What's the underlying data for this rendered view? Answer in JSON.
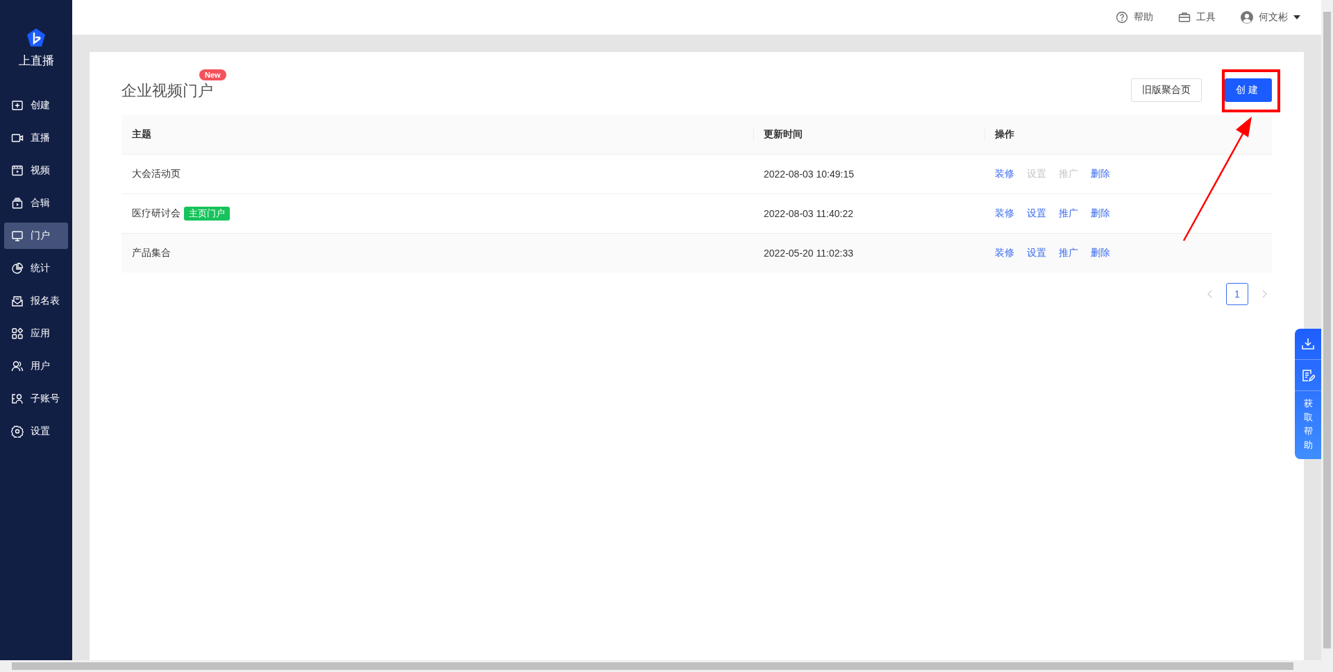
{
  "sidebar": {
    "brand": "上直播",
    "items": [
      {
        "label": "创建",
        "selected": false
      },
      {
        "label": "直播",
        "selected": false
      },
      {
        "label": "视频",
        "selected": false
      },
      {
        "label": "合辑",
        "selected": false
      },
      {
        "label": "门户",
        "selected": true
      },
      {
        "label": "统计",
        "selected": false
      },
      {
        "label": "报名表",
        "selected": false
      },
      {
        "label": "应用",
        "selected": false
      },
      {
        "label": "用户",
        "selected": false
      },
      {
        "label": "子账号",
        "selected": false
      },
      {
        "label": "设置",
        "selected": false
      }
    ]
  },
  "topbar": {
    "help": "帮助",
    "tools": "工具",
    "user": "何文彬"
  },
  "page": {
    "title": "企业视频门户",
    "badge": "New",
    "buttons": [
      {
        "label": "旧版聚合页",
        "kind": "default"
      },
      {
        "label": "创建",
        "kind": "primary"
      }
    ]
  },
  "table": {
    "columns": [
      "主题",
      "更新时间",
      "操作"
    ],
    "rows": [
      {
        "subject": "大会活动页",
        "tag": null,
        "time": "2022-08-03 10:49:15",
        "actions": [
          {
            "label": "装修",
            "disabled": false
          },
          {
            "label": "设置",
            "disabled": true
          },
          {
            "label": "推广",
            "disabled": true
          },
          {
            "label": "删除",
            "disabled": false
          }
        ]
      },
      {
        "subject": "医疗研讨会",
        "tag": "主页门户",
        "time": "2022-08-03 11:40:22",
        "actions": [
          {
            "label": "装修",
            "disabled": false
          },
          {
            "label": "设置",
            "disabled": false
          },
          {
            "label": "推广",
            "disabled": false
          },
          {
            "label": "删除",
            "disabled": false
          }
        ]
      },
      {
        "subject": "产品集合",
        "tag": null,
        "time": "2022-05-20 11:02:33",
        "actions": [
          {
            "label": "装修",
            "disabled": false
          },
          {
            "label": "设置",
            "disabled": false
          },
          {
            "label": "推广",
            "disabled": false
          },
          {
            "label": "删除",
            "disabled": false
          }
        ]
      }
    ]
  },
  "pagination": {
    "prev_disabled": true,
    "next_disabled": true,
    "pages": [
      {
        "label": "1",
        "selected": true
      }
    ]
  },
  "help_panel": {
    "label": "获取帮助"
  }
}
